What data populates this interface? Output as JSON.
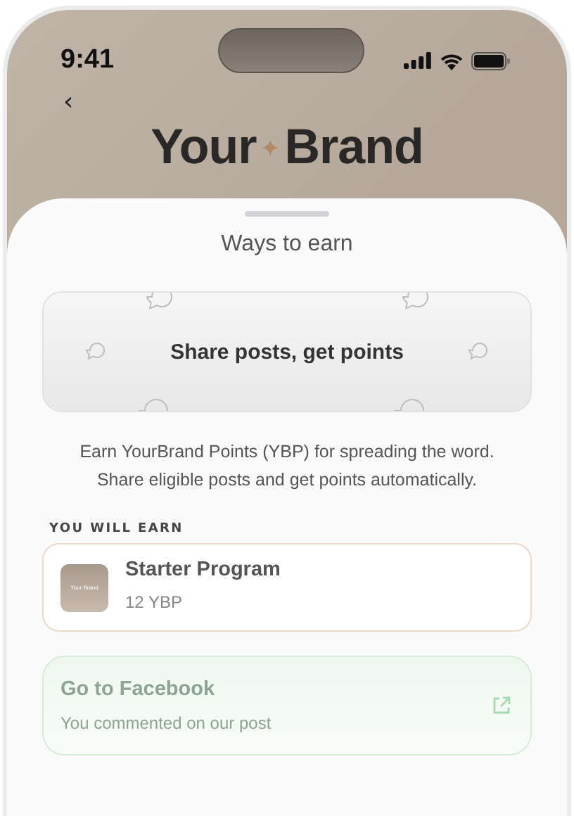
{
  "status_bar": {
    "time": "9:41"
  },
  "header": {
    "back": "‹",
    "brand_left": "Your",
    "brand_right": "Brand"
  },
  "sheet": {
    "title": "Ways to earn",
    "banner": {
      "title": "Share posts, get points"
    },
    "description": "Earn YourBrand Points (YBP) for spreading the word. Share eligible posts and get points automatically.",
    "section_label": "YOU WILL EARN",
    "reward": {
      "thumbnail_left": "Your",
      "thumbnail_right": "Brand",
      "title": "Starter Program",
      "amount": "12 YBP"
    },
    "action": {
      "title": "Go to Facebook",
      "subtitle": "You commented on our post"
    }
  }
}
